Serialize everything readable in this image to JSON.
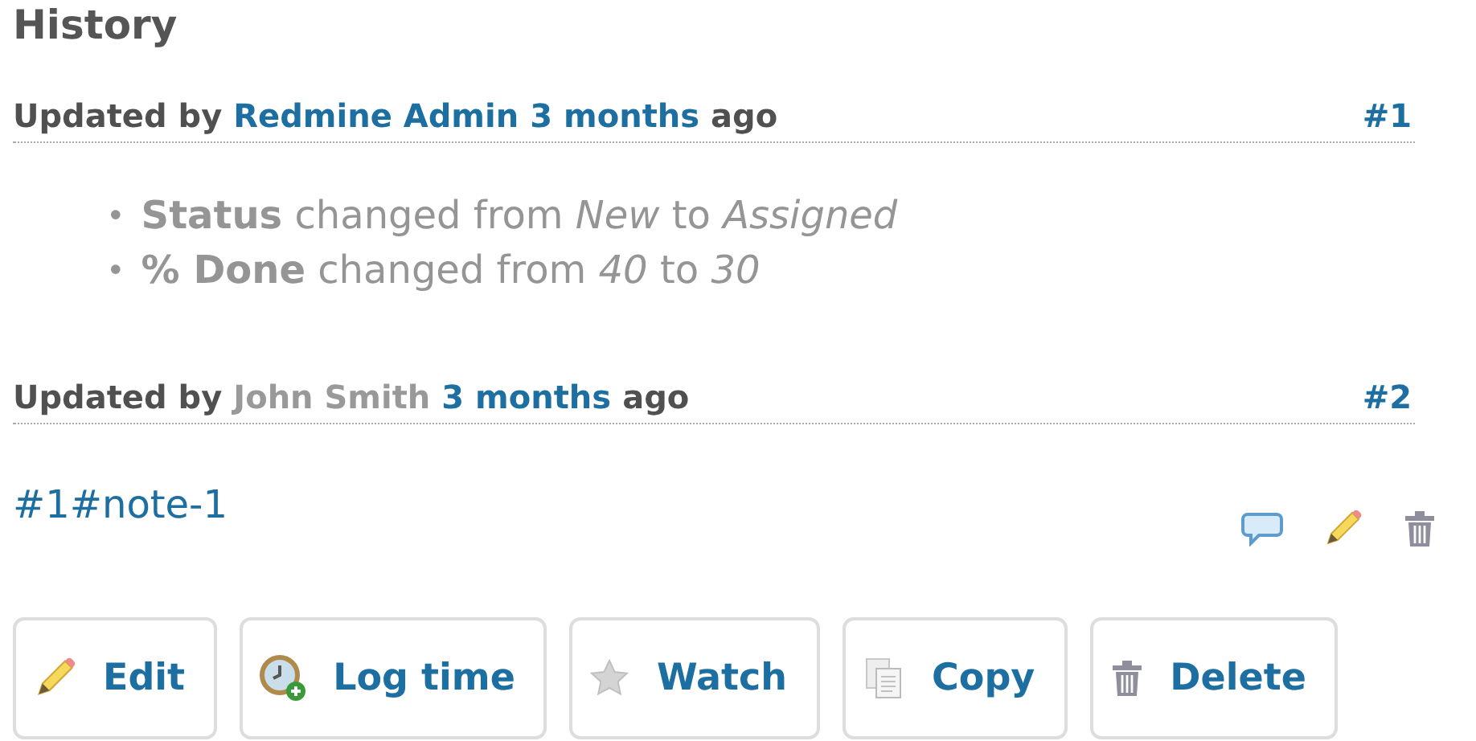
{
  "title": "History",
  "journals": [
    {
      "prefix": "Updated by",
      "author": "Redmine Admin",
      "author_is_link": true,
      "time": "3 months",
      "suffix": "ago",
      "number": "#1",
      "details": [
        {
          "marker": "•",
          "text": "**Status** changed from *New* to *Assigned*"
        },
        {
          "marker": "•",
          "text": "**% Done** changed from *40* to *30*"
        }
      ]
    },
    {
      "prefix": "Updated by",
      "author": "John Smith",
      "author_is_link": false,
      "time": "3 months",
      "suffix": "ago",
      "number": "#2",
      "note": "#1#note-1",
      "actions": [
        {
          "kind": "quote"
        },
        {
          "kind": "edit"
        },
        {
          "kind": "delete"
        }
      ]
    }
  ],
  "buttons": [
    {
      "label": "Edit",
      "kind": "edit"
    },
    {
      "label": "Log time",
      "kind": "log"
    },
    {
      "label": "Watch",
      "kind": "watch"
    },
    {
      "label": "Copy",
      "kind": "copy"
    },
    {
      "label": "Delete",
      "kind": "delete"
    }
  ]
}
